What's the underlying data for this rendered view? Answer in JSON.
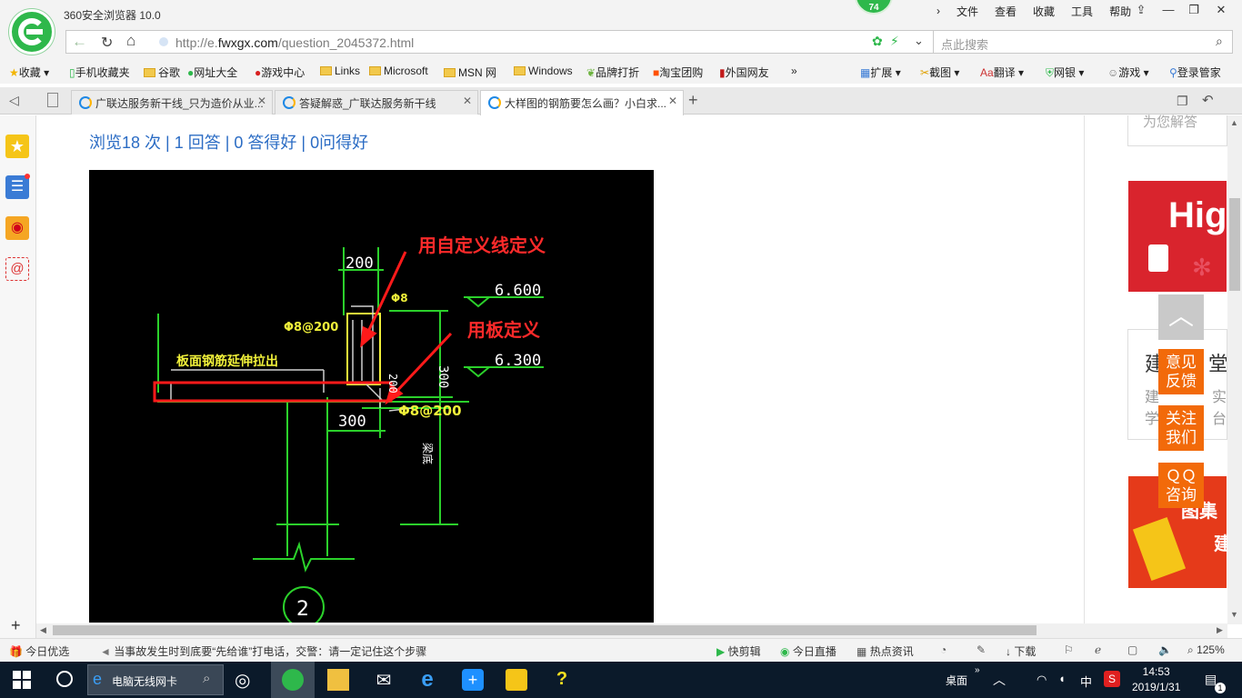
{
  "browser": {
    "title": "360安全浏览器 10.0",
    "badge_count": "74",
    "menu": [
      "文件",
      "查看",
      "收藏",
      "工具",
      "帮助"
    ],
    "url_prefix": "http://e.",
    "url_domain": "fwxgx.com",
    "url_path": "/question_2045372.html",
    "search_placeholder": "点此搜索"
  },
  "bookmarks": {
    "left": [
      "收藏",
      "手机收藏夹",
      "谷歌",
      "网址大全",
      "游戏中心",
      "Links",
      "Microsoft",
      "MSN 网",
      "Windows",
      "品牌打折",
      "淘宝团购",
      "外国网友"
    ],
    "right": [
      "扩展",
      "截图",
      "翻译",
      "网银",
      "游戏",
      "登录管家"
    ]
  },
  "tabs": [
    {
      "label": "广联达服务新干线_只为造价从业..."
    },
    {
      "label": "答疑解惑_广联达服务新干线"
    },
    {
      "label": "大样图的钢筋要怎么画？小白求..."
    }
  ],
  "page": {
    "stats": "浏览18 次 | 1 回答 | 0 答得好 | 0问得好"
  },
  "cad": {
    "annotation1": "用自定义线定义",
    "annotation2": "用板定义",
    "dim_200": "200",
    "dim_300": "300",
    "dim_300_vertical": "300",
    "dim_200_vertical": "200",
    "level_top": "6.600",
    "level_mid": "6.300",
    "rebar_phi8": "Φ8",
    "rebar_left": "Φ8@200",
    "rebar_bottom": "Φ8@200",
    "slab_note": "板面钢筋延伸拉出",
    "beam_label": "梁底",
    "section_mark": "2"
  },
  "right_ads": {
    "ad0_text": "为您解答",
    "ad1_text": "Hig",
    "ad2_title": "建",
    "ad2_title2": "堂",
    "ad2_line1": "建",
    "ad2_line1b": "实",
    "ad2_line2": "学",
    "ad2_line2b": "台",
    "ad3_text": "图集",
    "ad3_text2": "建"
  },
  "float_buttons": {
    "top_icon": "chevron-up",
    "feedback": [
      "意见",
      "反馈"
    ],
    "follow": [
      "关注",
      "我们"
    ],
    "qq": [
      "ＱＱ",
      "咨询"
    ]
  },
  "statusbar": {
    "today": "今日优选",
    "news": "当事故发生时到底要“先给谁”打电话，交警：请一定记住这个步骤",
    "quickcut": "快剪辑",
    "live": "今日直播",
    "hot": "热点资讯",
    "download": "下载",
    "zoom": "125%"
  },
  "taskbar": {
    "search_text": "电脑无线网卡",
    "desktop": "桌面",
    "ime": "中",
    "time": "14:53",
    "date": "2019/1/31",
    "notification_count": "1"
  }
}
